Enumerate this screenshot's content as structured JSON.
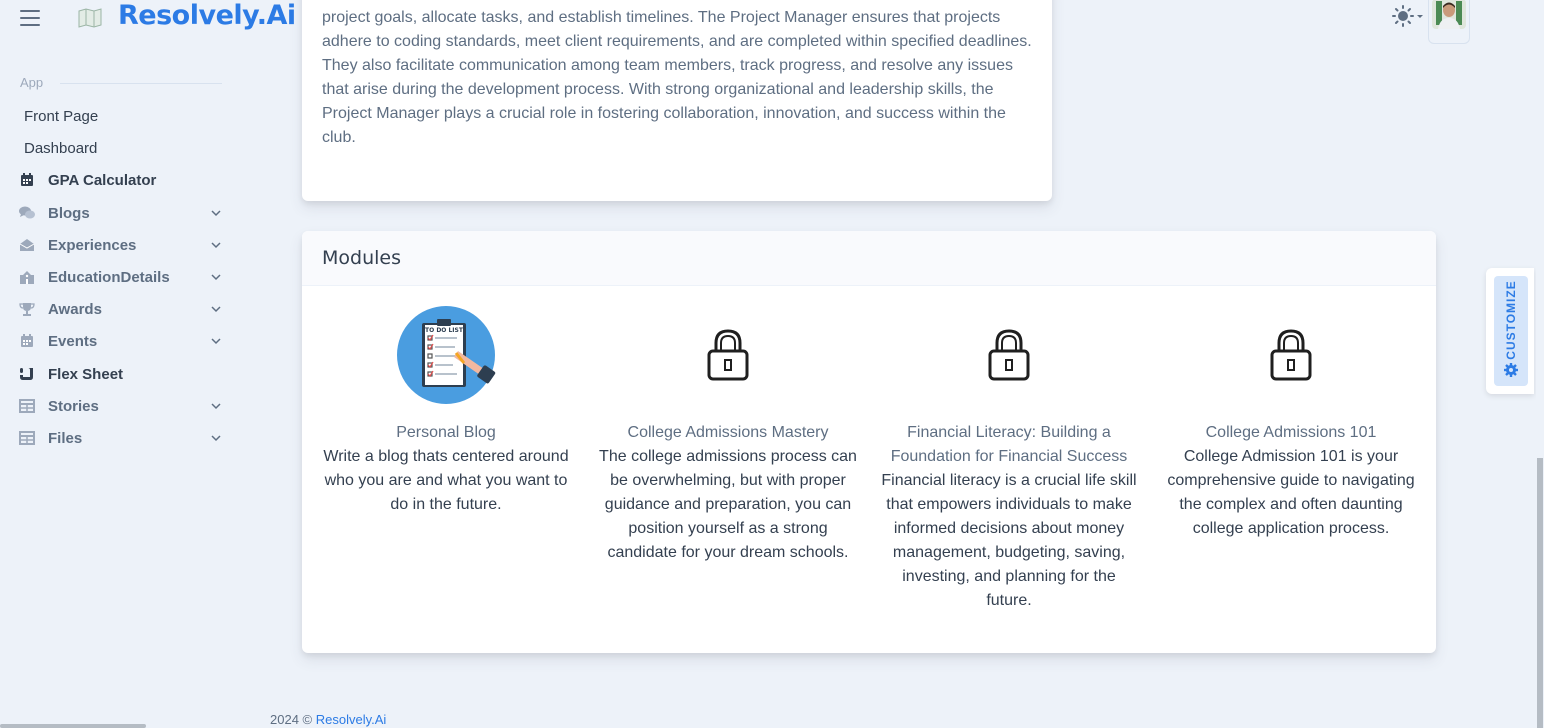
{
  "brand": {
    "name": "Resolvely.Ai"
  },
  "sidebar": {
    "section_label": "App",
    "items": [
      {
        "label": "Front Page",
        "icon": "none",
        "expandable": false
      },
      {
        "label": "Dashboard",
        "icon": "none",
        "expandable": false
      },
      {
        "label": "GPA Calculator",
        "icon": "calendar-icon",
        "expandable": false
      },
      {
        "label": "Blogs",
        "icon": "comments-icon",
        "expandable": true
      },
      {
        "label": "Experiences",
        "icon": "envelope-open-icon",
        "expandable": true
      },
      {
        "label": "EducationDetails",
        "icon": "school-icon",
        "expandable": true
      },
      {
        "label": "Awards",
        "icon": "trophy-icon",
        "expandable": true
      },
      {
        "label": "Events",
        "icon": "calendar-icon",
        "expandable": true
      },
      {
        "label": "Flex Sheet",
        "icon": "scroll-icon",
        "expandable": false
      },
      {
        "label": "Stories",
        "icon": "table-icon",
        "expandable": true
      },
      {
        "label": "Files",
        "icon": "table-icon",
        "expandable": true
      }
    ]
  },
  "intro_card": {
    "text": "project goals, allocate tasks, and establish timelines. The Project Manager ensures that projects adhere to coding standards, meet client requirements, and are completed within specified deadlines. They also facilitate communication among team members, track progress, and resolve any issues that arise during the development process. With strong organizational and leadership skills, the Project Manager plays a crucial role in fostering collaboration, innovation, and success within the club."
  },
  "modules": {
    "title": "Modules",
    "items": [
      {
        "title": "Personal Blog",
        "description": "Write a blog thats centered around who you are and what you want to do in the future.",
        "locked": false,
        "image": "to-do-list-illustration",
        "image_text": "TO DO LIST"
      },
      {
        "title": "College Admissions Mastery",
        "description": "The college admissions process can be overwhelming, but with proper guidance and preparation, you can position yourself as a strong candidate for your dream schools.",
        "locked": true
      },
      {
        "title": "Financial Literacy: Building a Foundation for Financial Success",
        "description": "Financial literacy is a crucial life skill that empowers individuals to make informed decisions about money management, budgeting, saving, investing, and planning for the future.",
        "locked": true
      },
      {
        "title": "College Admissions 101",
        "description": "College Admission 101 is your comprehensive guide to navigating the complex and often daunting college application process.",
        "locked": true
      }
    ]
  },
  "customize": {
    "label": "CUSTOMIZE"
  },
  "footer": {
    "year_text": "2024 ©",
    "link_text": "Resolvely.Ai"
  },
  "colors": {
    "brand": "#2c7be5",
    "background": "#edf2f9",
    "text": "#5e6e82",
    "heading": "#344050"
  }
}
